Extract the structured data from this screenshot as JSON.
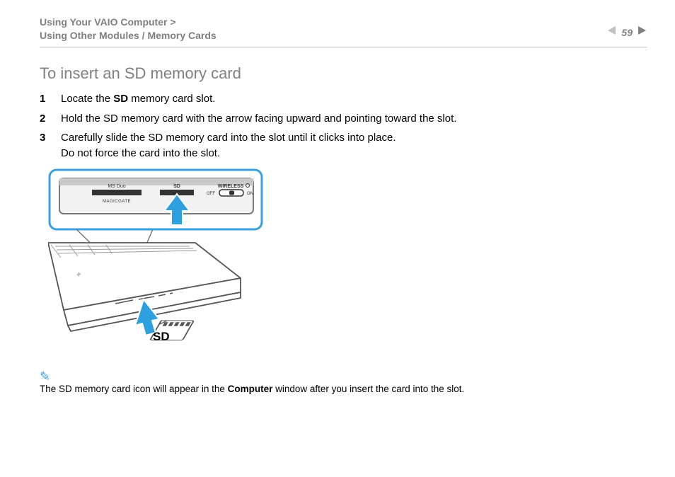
{
  "header": {
    "breadcrumb_line1": "Using Your VAIO Computer >",
    "breadcrumb_line2": "Using Other Modules / Memory Cards",
    "page_number": "59"
  },
  "title": "To insert an SD memory card",
  "steps": [
    {
      "num": "1",
      "pre": "Locate the ",
      "bold": "SD",
      "post": " memory card slot."
    },
    {
      "num": "2",
      "text": "Hold the SD memory card with the arrow facing upward and pointing toward the slot."
    },
    {
      "num": "3",
      "line1": "Carefully slide the SD memory card into the slot until it clicks into place.",
      "line2": "Do not force the card into the slot."
    }
  ],
  "figure": {
    "panel_labels": {
      "msduo": "MS Duo",
      "sd": "SD",
      "wireless": "WIRELESS",
      "off": "OFF",
      "on": "ON",
      "magicgate": "MAGICGATE"
    },
    "card_label": "SD"
  },
  "note": {
    "pre": "The SD memory card icon will appear in the ",
    "bold": "Computer",
    "post": " window after you insert the card into the slot."
  }
}
